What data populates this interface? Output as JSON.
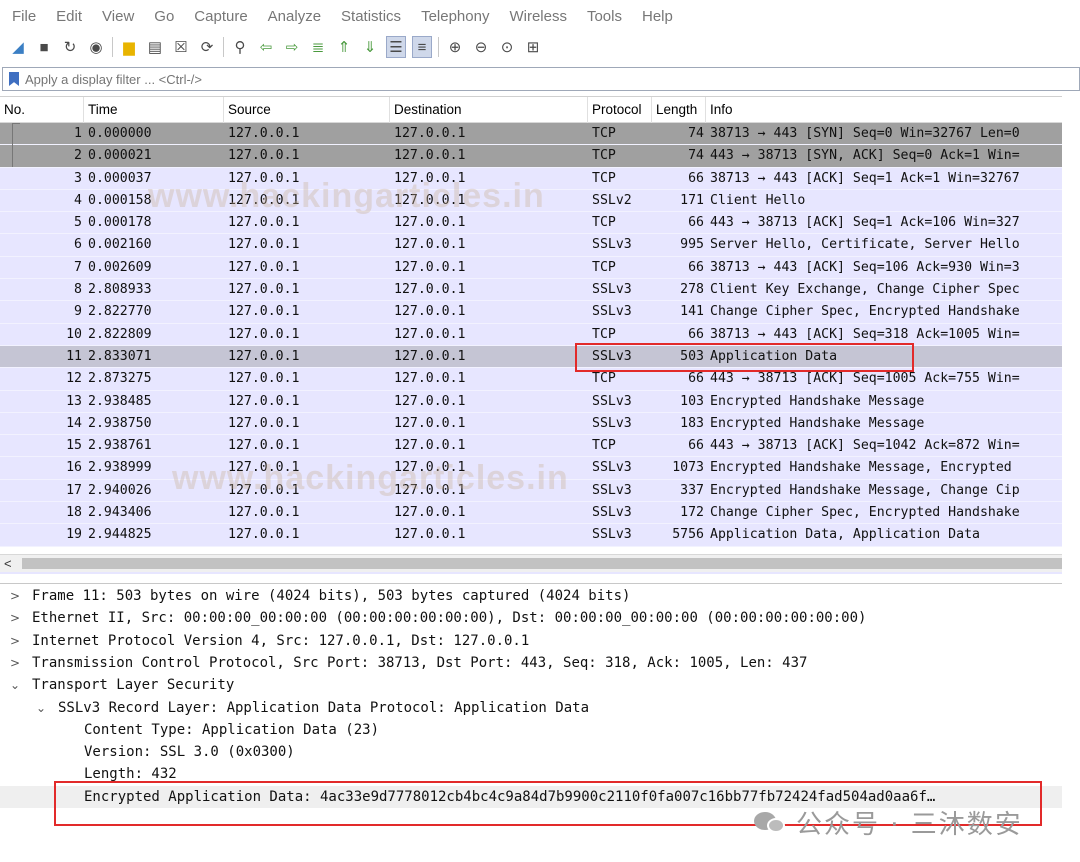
{
  "menu": [
    "File",
    "Edit",
    "View",
    "Go",
    "Capture",
    "Analyze",
    "Statistics",
    "Telephony",
    "Wireless",
    "Tools",
    "Help"
  ],
  "toolbar": {
    "icons": [
      "shark-fin-start-icon",
      "stop-square-icon",
      "restart-fin-icon",
      "options-gear-icon",
      "open-folder-icon",
      "save-file-icon",
      "close-file-icon",
      "reload-file-icon",
      "find-magnifier-icon",
      "go-back-arrow-icon",
      "go-forward-arrow-icon",
      "go-to-packet-icon",
      "first-packet-icon",
      "last-packet-icon",
      "autoscroll-icon",
      "colorize-icon",
      "zoom-in-icon",
      "zoom-out-icon",
      "zoom-normal-icon",
      "resize-columns-icon"
    ]
  },
  "filter": {
    "placeholder": "Apply a display filter ... <Ctrl-/>"
  },
  "columns": {
    "no": "No.",
    "time": "Time",
    "source": "Source",
    "destination": "Destination",
    "protocol": "Protocol",
    "length": "Length",
    "info": "Info"
  },
  "packets": [
    {
      "no": "1",
      "time": "0.000000",
      "src": "127.0.0.1",
      "dst": "127.0.0.1",
      "proto": "TCP",
      "len": "74",
      "info": "38713 → 443 [SYN] Seq=0 Win=32767 Len=0"
    },
    {
      "no": "2",
      "time": "0.000021",
      "src": "127.0.0.1",
      "dst": "127.0.0.1",
      "proto": "TCP",
      "len": "74",
      "info": "443 → 38713 [SYN, ACK] Seq=0 Ack=1 Win="
    },
    {
      "no": "3",
      "time": "0.000037",
      "src": "127.0.0.1",
      "dst": "127.0.0.1",
      "proto": "TCP",
      "len": "66",
      "info": "38713 → 443 [ACK] Seq=1 Ack=1 Win=32767"
    },
    {
      "no": "4",
      "time": "0.000158",
      "src": "127.0.0.1",
      "dst": "127.0.0.1",
      "proto": "SSLv2",
      "len": "171",
      "info": "Client Hello"
    },
    {
      "no": "5",
      "time": "0.000178",
      "src": "127.0.0.1",
      "dst": "127.0.0.1",
      "proto": "TCP",
      "len": "66",
      "info": "443 → 38713 [ACK] Seq=1 Ack=106 Win=327"
    },
    {
      "no": "6",
      "time": "0.002160",
      "src": "127.0.0.1",
      "dst": "127.0.0.1",
      "proto": "SSLv3",
      "len": "995",
      "info": "Server Hello, Certificate, Server Hello"
    },
    {
      "no": "7",
      "time": "0.002609",
      "src": "127.0.0.1",
      "dst": "127.0.0.1",
      "proto": "TCP",
      "len": "66",
      "info": "38713 → 443 [ACK] Seq=106 Ack=930 Win=3"
    },
    {
      "no": "8",
      "time": "2.808933",
      "src": "127.0.0.1",
      "dst": "127.0.0.1",
      "proto": "SSLv3",
      "len": "278",
      "info": "Client Key Exchange, Change Cipher Spec"
    },
    {
      "no": "9",
      "time": "2.822770",
      "src": "127.0.0.1",
      "dst": "127.0.0.1",
      "proto": "SSLv3",
      "len": "141",
      "info": "Change Cipher Spec, Encrypted Handshake"
    },
    {
      "no": "10",
      "time": "2.822809",
      "src": "127.0.0.1",
      "dst": "127.0.0.1",
      "proto": "TCP",
      "len": "66",
      "info": "38713 → 443 [ACK] Seq=318 Ack=1005 Win="
    },
    {
      "no": "11",
      "time": "2.833071",
      "src": "127.0.0.1",
      "dst": "127.0.0.1",
      "proto": "SSLv3",
      "len": "503",
      "info": "Application Data"
    },
    {
      "no": "12",
      "time": "2.873275",
      "src": "127.0.0.1",
      "dst": "127.0.0.1",
      "proto": "TCP",
      "len": "66",
      "info": "443 → 38713 [ACK] Seq=1005 Ack=755 Win="
    },
    {
      "no": "13",
      "time": "2.938485",
      "src": "127.0.0.1",
      "dst": "127.0.0.1",
      "proto": "SSLv3",
      "len": "103",
      "info": "Encrypted Handshake Message"
    },
    {
      "no": "14",
      "time": "2.938750",
      "src": "127.0.0.1",
      "dst": "127.0.0.1",
      "proto": "SSLv3",
      "len": "183",
      "info": "Encrypted Handshake Message"
    },
    {
      "no": "15",
      "time": "2.938761",
      "src": "127.0.0.1",
      "dst": "127.0.0.1",
      "proto": "TCP",
      "len": "66",
      "info": "443 → 38713 [ACK] Seq=1042 Ack=872 Win="
    },
    {
      "no": "16",
      "time": "2.938999",
      "src": "127.0.0.1",
      "dst": "127.0.0.1",
      "proto": "SSLv3",
      "len": "1073",
      "info": "Encrypted Handshake Message, Encrypted"
    },
    {
      "no": "17",
      "time": "2.940026",
      "src": "127.0.0.1",
      "dst": "127.0.0.1",
      "proto": "SSLv3",
      "len": "337",
      "info": "Encrypted Handshake Message, Change Cip"
    },
    {
      "no": "18",
      "time": "2.943406",
      "src": "127.0.0.1",
      "dst": "127.0.0.1",
      "proto": "SSLv3",
      "len": "172",
      "info": "Change Cipher Spec, Encrypted Handshake"
    },
    {
      "no": "19",
      "time": "2.944825",
      "src": "127.0.0.1",
      "dst": "127.0.0.1",
      "proto": "SSLv3",
      "len": "5756",
      "info": "Application Data, Application Data"
    }
  ],
  "watermark": "www.hackingarticles.in",
  "scroll_arrow": "<",
  "details": [
    {
      "text": "Frame 11: 503 bytes on wire (4024 bits), 503 bytes captured (4024 bits)",
      "arrow": ">"
    },
    {
      "text": "Ethernet II, Src: 00:00:00_00:00:00 (00:00:00:00:00:00), Dst: 00:00:00_00:00:00 (00:00:00:00:00:00)",
      "arrow": ">"
    },
    {
      "text": "Internet Protocol Version 4, Src: 127.0.0.1, Dst: 127.0.0.1",
      "arrow": ">"
    },
    {
      "text": "Transmission Control Protocol, Src Port: 38713, Dst Port: 443, Seq: 318, Ack: 1005, Len: 437",
      "arrow": ">"
    },
    {
      "text": "Transport Layer Security",
      "arrow": "⌄"
    },
    {
      "text": "SSLv3 Record Layer: Application Data Protocol: Application Data",
      "arrow": "⌄"
    },
    {
      "text": "Content Type: Application Data (23)",
      "arrow": ""
    },
    {
      "text": "Version: SSL 3.0 (0x0300)",
      "arrow": ""
    },
    {
      "text": "Length: 432",
      "arrow": ""
    },
    {
      "text": "Encrypted Application Data: 4ac33e9d7778012cb4bc4c9a84d7b9900c2110f0fa007c16bb77fb72424fad504ad0aa6f…",
      "arrow": ""
    }
  ],
  "brand": "公众号 · 三沐数安",
  "colors": {
    "row_default": "#e7e6ff",
    "row_tcp_syn": "#a0a0a0",
    "row_selected": "#c5c5d4",
    "highlight_box": "#e22a2a"
  }
}
